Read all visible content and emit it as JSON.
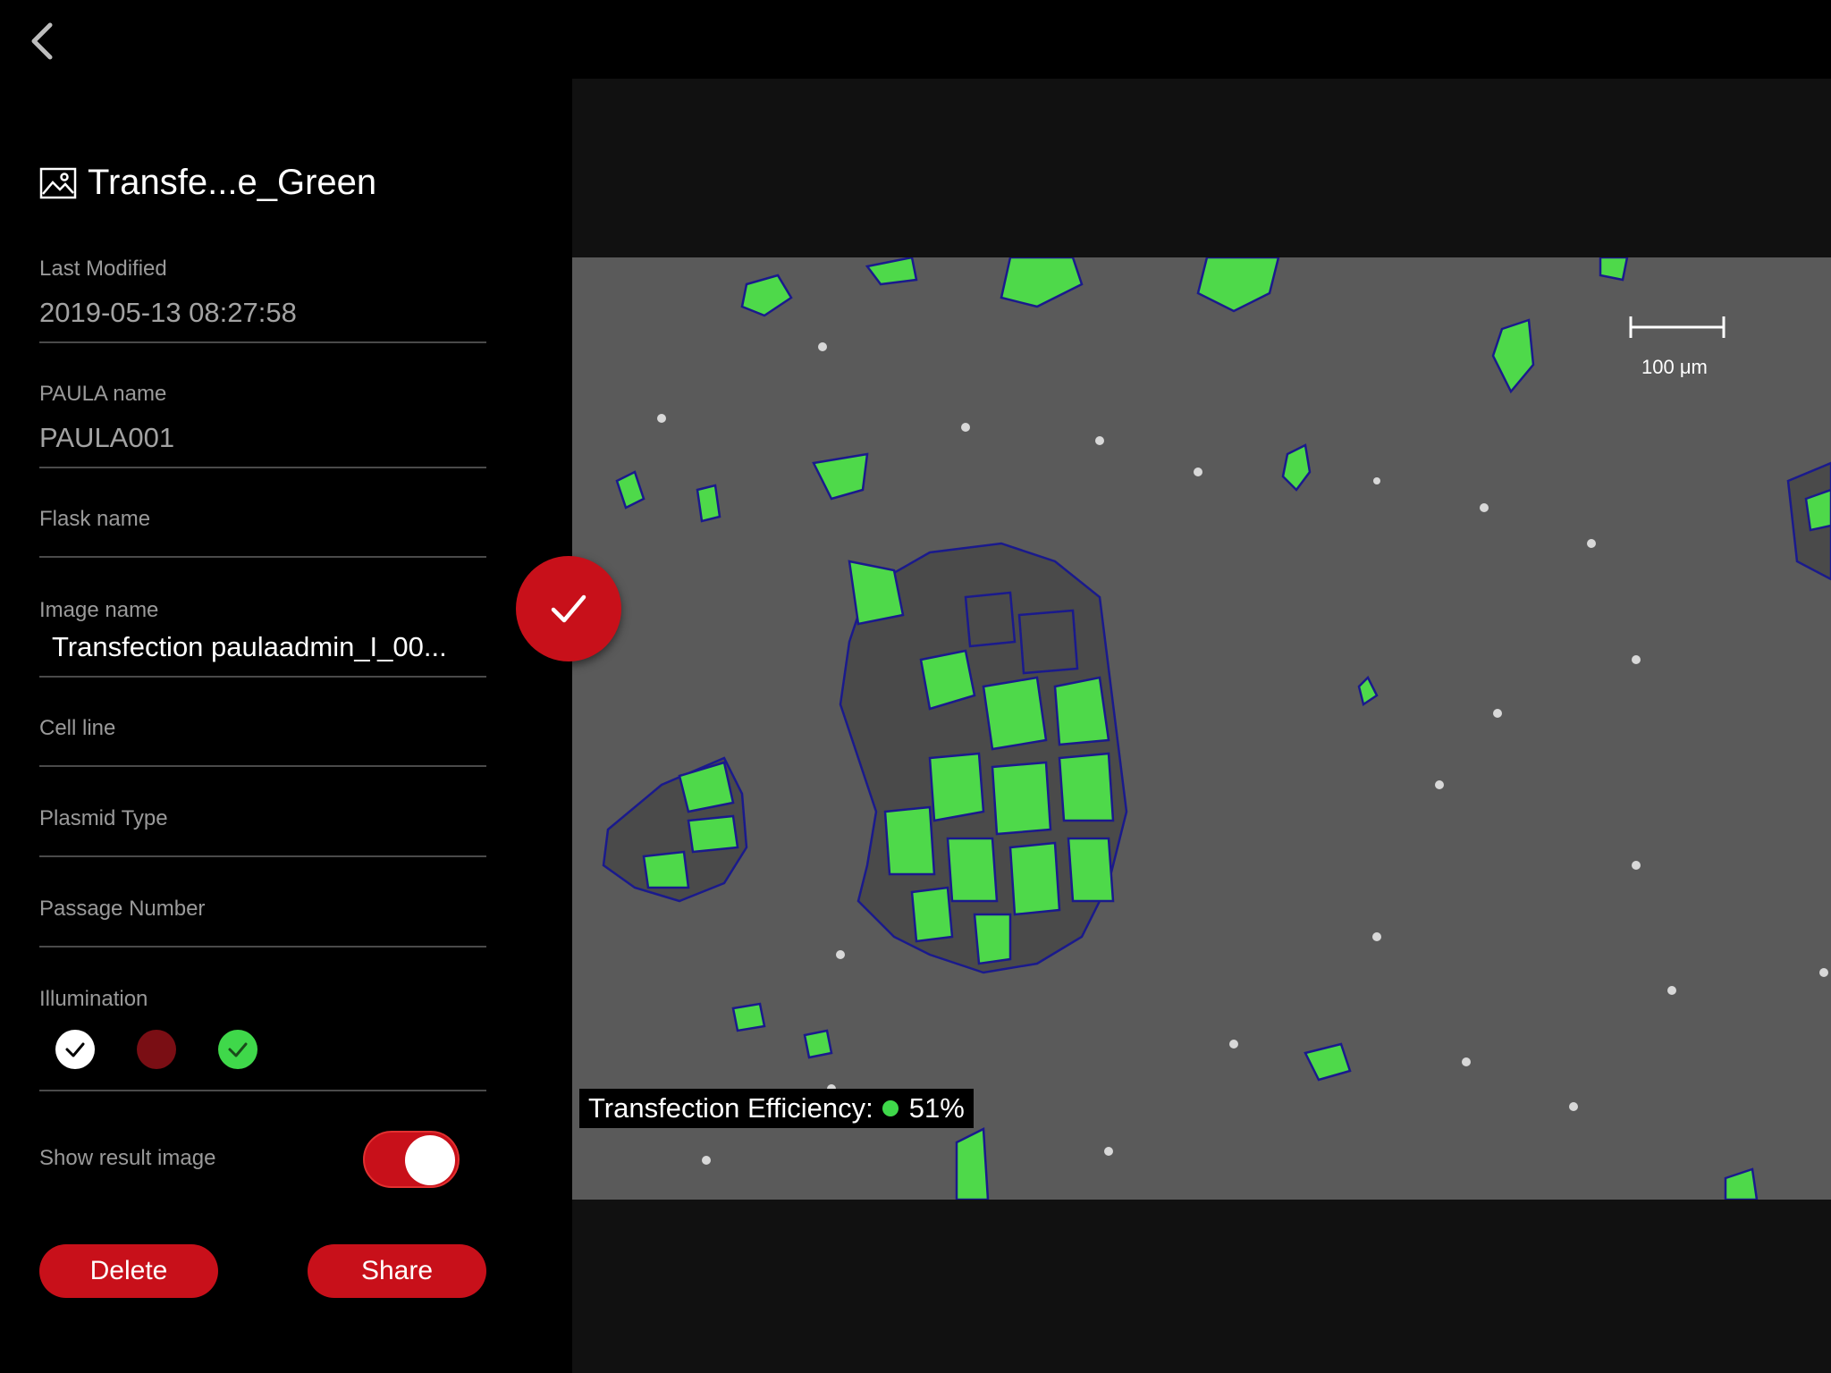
{
  "sidebar": {
    "title": "Transfe...e_Green",
    "fields": [
      {
        "label": "Last Modified",
        "value": "2019-05-13 08:27:58"
      },
      {
        "label": "PAULA name",
        "value": "PAULA001"
      },
      {
        "label": "Flask name",
        "value": ""
      },
      {
        "label": "Image name",
        "value": "Transfection paulaadmin_I_00..."
      },
      {
        "label": "Cell line",
        "value": ""
      },
      {
        "label": "Plasmid Type",
        "value": ""
      },
      {
        "label": "Passage Number",
        "value": ""
      }
    ],
    "illumination": {
      "label": "Illumination",
      "options": [
        {
          "name": "white",
          "color": "#ffffff",
          "selected": true
        },
        {
          "name": "red",
          "color": "#7a0e14",
          "selected": false
        },
        {
          "name": "green",
          "color": "#3fd84a",
          "selected": true
        }
      ]
    },
    "show_result": {
      "label": "Show result image",
      "on": true
    },
    "delete_label": "Delete",
    "share_label": "Share"
  },
  "viewer": {
    "scale_label": "100 μm",
    "efficiency_label": "Transfection Efficiency:",
    "efficiency_value": "51%"
  },
  "colors": {
    "accent": "#c8101a",
    "cell_fill": "#4ed94a",
    "cell_outline": "#1a1a8c",
    "background": "#5a5a5a"
  }
}
